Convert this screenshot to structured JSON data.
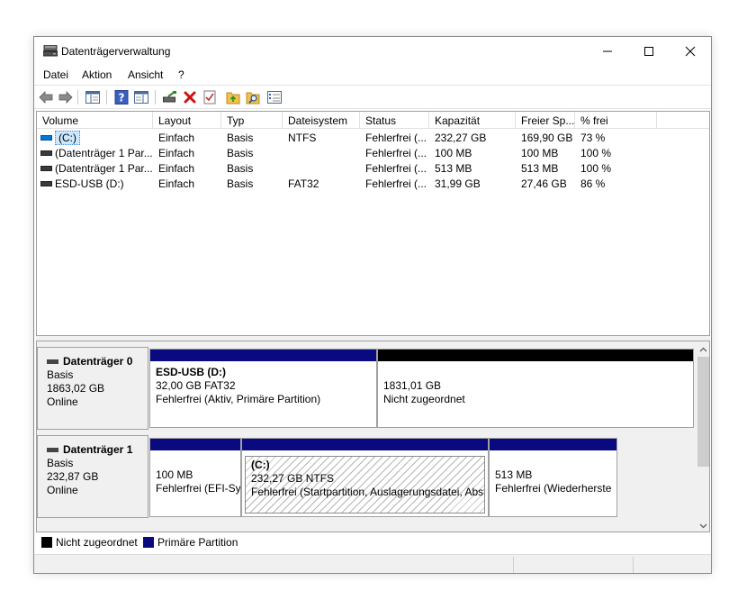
{
  "window": {
    "title": "Datenträgerverwaltung"
  },
  "menu": [
    "Datei",
    "Aktion",
    "Ansicht",
    "?"
  ],
  "columns": [
    "Volume",
    "Layout",
    "Typ",
    "Dateisystem",
    "Status",
    "Kapazität",
    "Freier Sp...",
    "% frei"
  ],
  "volumes": [
    {
      "name": "(C:)",
      "layout": "Einfach",
      "type": "Basis",
      "fs": "NTFS",
      "status": "Fehlerfrei (...",
      "capacity": "232,27 GB",
      "free": "169,90 GB",
      "pct": "73 %",
      "selected": true
    },
    {
      "name": "(Datenträger 1 Par...",
      "layout": "Einfach",
      "type": "Basis",
      "fs": "",
      "status": "Fehlerfrei (...",
      "capacity": "100 MB",
      "free": "100 MB",
      "pct": "100 %",
      "selected": false
    },
    {
      "name": "(Datenträger 1 Par...",
      "layout": "Einfach",
      "type": "Basis",
      "fs": "",
      "status": "Fehlerfrei (...",
      "capacity": "513 MB",
      "free": "513 MB",
      "pct": "100 %",
      "selected": false
    },
    {
      "name": "ESD-USB (D:)",
      "layout": "Einfach",
      "type": "Basis",
      "fs": "FAT32",
      "status": "Fehlerfrei (...",
      "capacity": "31,99 GB",
      "free": "27,46 GB",
      "pct": "86 %",
      "selected": false
    }
  ],
  "disks": [
    {
      "title": "Datenträger 0",
      "type": "Basis",
      "size": "1863,02 GB",
      "state": "Online",
      "partitions": [
        {
          "title": "ESD-USB  (D:)",
          "line1": "32,00 GB FAT32",
          "line2": "Fehlerfrei (Aktiv, Primäre Partition)",
          "kind": "primary"
        },
        {
          "title": "",
          "line1": "1831,01 GB",
          "line2": "Nicht zugeordnet",
          "kind": "unallocated"
        }
      ]
    },
    {
      "title": "Datenträger 1",
      "type": "Basis",
      "size": "232,87 GB",
      "state": "Online",
      "partitions": [
        {
          "title": "",
          "line1": "100 MB",
          "line2": "Fehlerfrei (EFI-Sy",
          "kind": "primary"
        },
        {
          "title": "(C:)",
          "line1": "232,27 GB NTFS",
          "line2": "Fehlerfrei (Startpartition, Auslagerungsdatei, Abst",
          "kind": "primary-selected"
        },
        {
          "title": "",
          "line1": "513 MB",
          "line2": "Fehlerfrei (Wiederherste",
          "kind": "primary"
        }
      ]
    }
  ],
  "legend": [
    {
      "label": "Nicht zugeordnet",
      "color": "#000000"
    },
    {
      "label": "Primäre Partition",
      "color": "#0a0a80"
    }
  ],
  "colors": {
    "primary": "#0a0a80",
    "unallocated": "#000000",
    "selection": "#cce8ff"
  }
}
